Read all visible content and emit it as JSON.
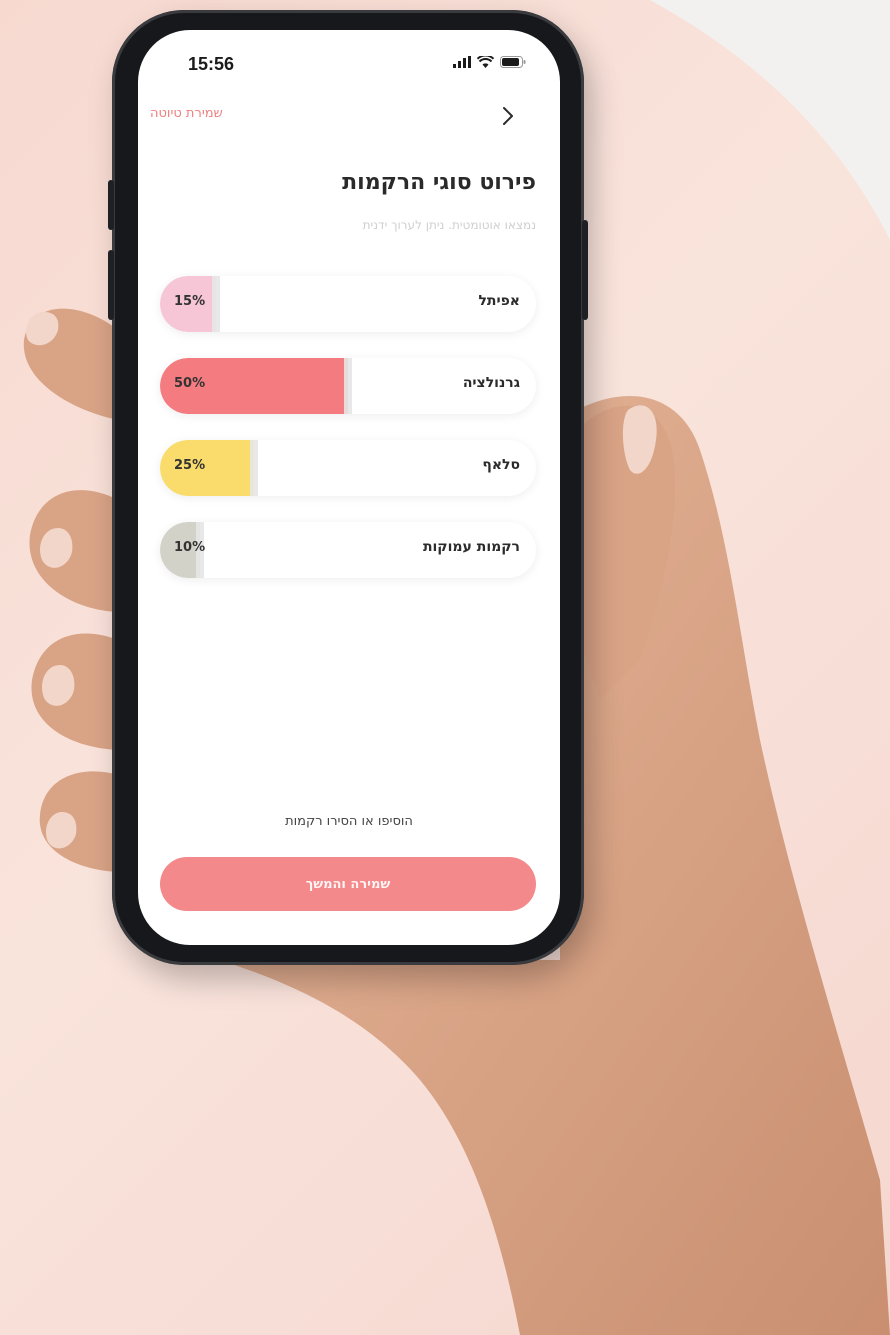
{
  "status_bar": {
    "time": "15:56"
  },
  "topbar": {
    "draft_link": "שמירת טיוטה"
  },
  "page": {
    "title": "פירוט סוגי הרקמות",
    "subtitle": "נמצאו אוטומטית. ניתן לערוך ידנית"
  },
  "tissues": [
    {
      "label": "אפיתל",
      "percent_text": "15%",
      "value": 15,
      "color": "#f7c6d6"
    },
    {
      "label": "גרנולציה",
      "percent_text": "50%",
      "value": 50,
      "color": "#f47c80"
    },
    {
      "label": "סלאף",
      "percent_text": "25%",
      "value": 25,
      "color": "#f9dc6b"
    },
    {
      "label": "רקמות עמוקות",
      "percent_text": "10%",
      "value": 10,
      "color": "#d3d2c8"
    }
  ],
  "footer": {
    "add_remove_link": "הוסיפו או הסירו רקמות",
    "save_button": "שמירה והמשך"
  },
  "colors": {
    "accent": "#f4898b",
    "link": "#f07f80"
  }
}
